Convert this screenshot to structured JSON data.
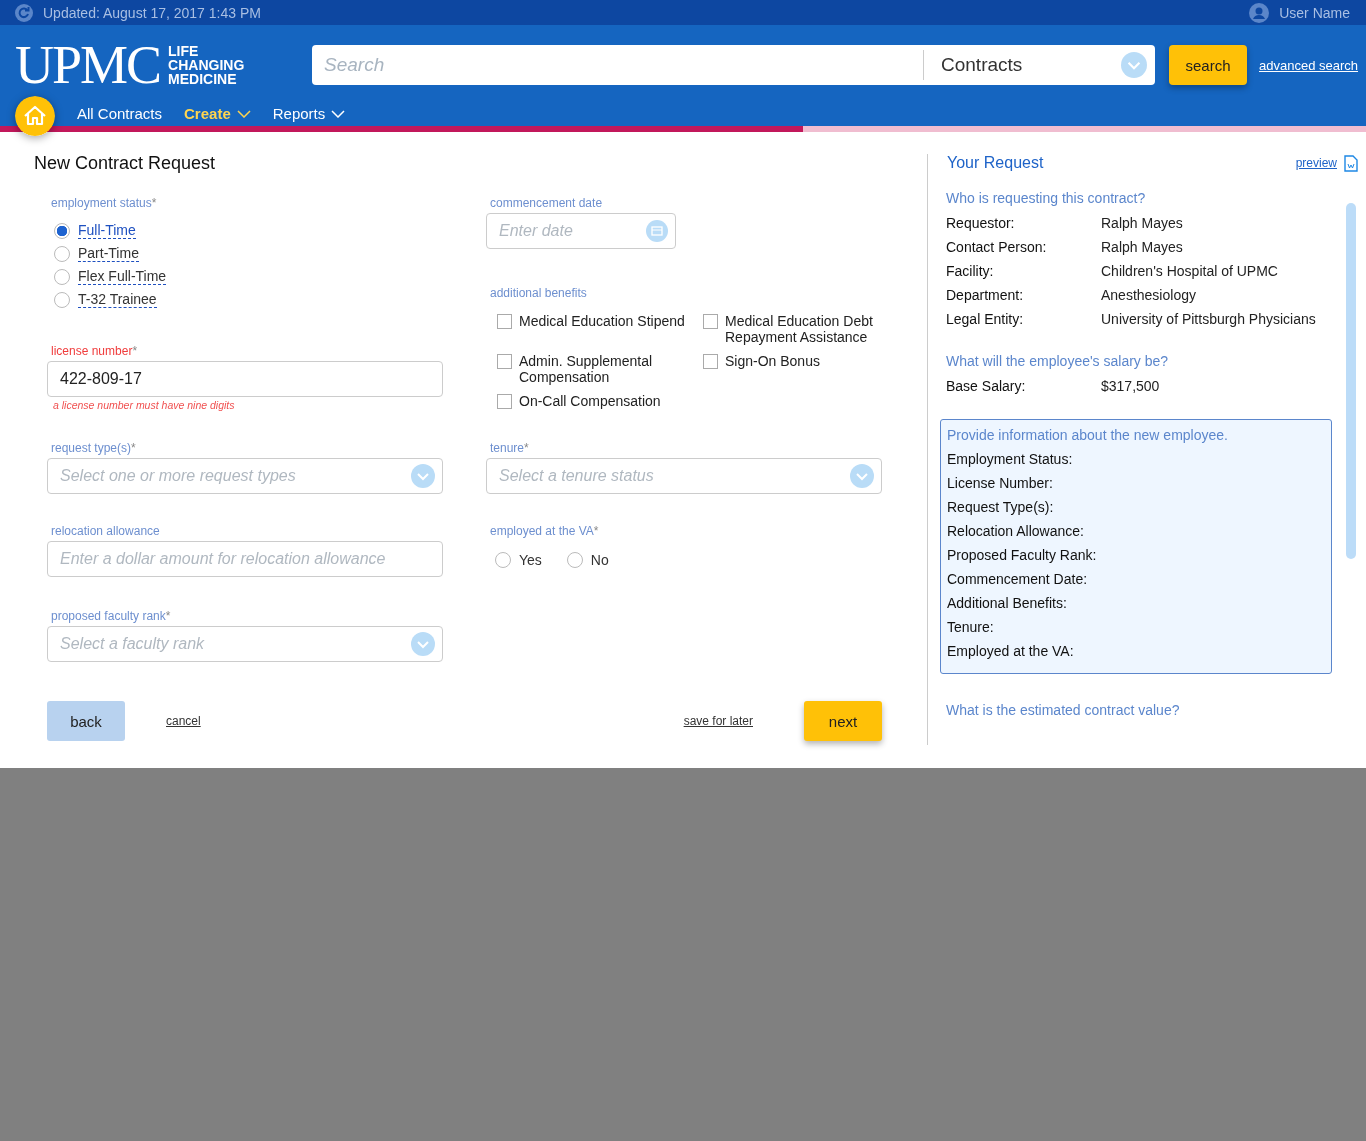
{
  "top_bar": {
    "updated": "Updated: August 17, 2017 1:43 PM",
    "user": "User Name"
  },
  "header": {
    "logo": {
      "wordmark": "UPMC",
      "tagline": [
        "LIFE",
        "CHANGING",
        "MEDICINE"
      ]
    },
    "search": {
      "placeholder": "Search",
      "scope": "Contracts",
      "button": "search",
      "advanced": "advanced search"
    },
    "nav": [
      {
        "label": "All Contracts",
        "selected": false,
        "dropdown": false
      },
      {
        "label": "Create",
        "selected": true,
        "dropdown": true
      },
      {
        "label": "Reports",
        "selected": false,
        "dropdown": true
      }
    ],
    "progress": {
      "level": 0.588
    }
  },
  "form": {
    "title": "New Contract Request",
    "employment_status": {
      "label": "employment status",
      "required_mark": "*",
      "options": [
        {
          "label": "Full-Time",
          "selected": true
        },
        {
          "label": "Part-Time",
          "selected": false
        },
        {
          "label": "Flex Full-Time",
          "selected": false
        },
        {
          "label": "T-32 Trainee",
          "selected": false
        }
      ]
    },
    "license_number": {
      "label": "license number",
      "required_mark": "*",
      "value": "422-809-17",
      "invalid": true,
      "error": "a license number must have nine digits"
    },
    "request_types": {
      "label": "request type(s)",
      "required_mark": "*",
      "placeholder": "Select one or more request types"
    },
    "relocation_allowance": {
      "label": "relocation allowance",
      "placeholder": "Enter a dollar amount for relocation allowance"
    },
    "faculty_rank": {
      "label": "proposed faculty rank",
      "required_mark": "*",
      "placeholder": "Select a faculty rank"
    },
    "commencement_date": {
      "label": "commencement date",
      "placeholder": "Enter date"
    },
    "additional_benefits": {
      "label": "additional benefits",
      "options": [
        {
          "label": "Medical Education Stipend",
          "checked": false
        },
        {
          "label": "Medical Education Debt Repayment Assistance",
          "checked": false
        },
        {
          "label": "Admin. Supplemental Compensation",
          "checked": false
        },
        {
          "label": "Sign-On Bonus",
          "checked": false
        },
        {
          "label": "On-Call Compensation",
          "checked": false
        }
      ]
    },
    "tenure": {
      "label": "tenure",
      "required_mark": "*",
      "placeholder": "Select a tenure status"
    },
    "employed_at_va": {
      "label": "employed at the VA",
      "required_mark": "*",
      "options": [
        {
          "label": "Yes",
          "selected": false
        },
        {
          "label": "No",
          "selected": false
        }
      ]
    },
    "buttons": {
      "back": "back",
      "cancel": "cancel",
      "save": "save for later",
      "next": "next"
    }
  },
  "sidebar": {
    "title": "Your Request",
    "preview": "preview",
    "sections": [
      {
        "kind": "plain",
        "heading": "Who is requesting this contract?",
        "rows": [
          {
            "label": "Requestor:",
            "value": "Ralph Mayes"
          },
          {
            "label": "Contact Person:",
            "value": "Ralph Mayes"
          },
          {
            "label": "Facility:",
            "value": "Children's Hospital of UPMC"
          },
          {
            "label": "Department:",
            "value": "Anesthesiology"
          },
          {
            "label": "Legal Entity:",
            "value": "University of Pittsburgh Physicians"
          }
        ]
      },
      {
        "kind": "plain",
        "heading": "What will the employee's salary be?",
        "rows": [
          {
            "label": "Base Salary:",
            "value": "$317,500"
          }
        ]
      },
      {
        "kind": "highlight",
        "heading": "Provide information about the new employee.",
        "rows": [
          {
            "label": "Employment Status:"
          },
          {
            "label": "License Number:"
          },
          {
            "label": "Request Type(s):"
          },
          {
            "label": "Relocation Allowance:"
          },
          {
            "label": "Proposed Faculty Rank:"
          },
          {
            "label": "Commencement Date:"
          },
          {
            "label": "Additional Benefits:"
          },
          {
            "label": "Tenure:"
          },
          {
            "label": "Employed at the VA:"
          }
        ]
      },
      {
        "kind": "plain",
        "heading": "What is the estimated contract value?"
      }
    ]
  }
}
